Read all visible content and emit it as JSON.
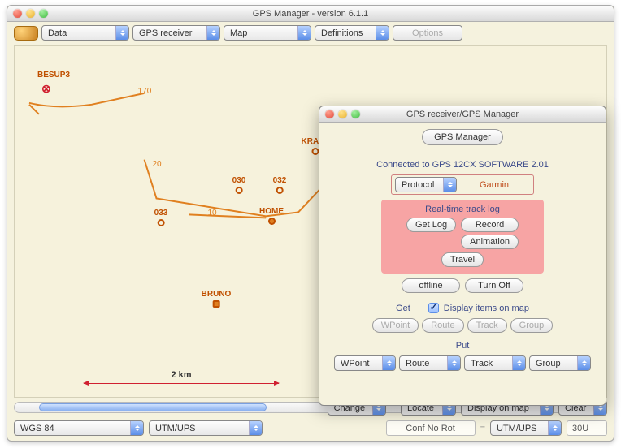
{
  "main": {
    "title": "GPS Manager - version 6.1.1",
    "toolbar": {
      "data": "Data",
      "gps": "GPS receiver",
      "map": "Map",
      "defs": "Definitions",
      "options": "Options"
    },
    "scale_label": "2 km",
    "bottom1": {
      "change": "Change",
      "eq": "=",
      "locate": "Locate",
      "display_on_map": "Display on map",
      "clear": "Clear"
    },
    "bottom2": {
      "datum": "WGS 84",
      "proj_left": "UTM/UPS",
      "conf": "Conf No Rot",
      "proj_right": "UTM/UPS",
      "zone": "30U"
    },
    "waypoints": {
      "besup3": "BESUP3",
      "track_170": "170",
      "track_20": "20",
      "wp_030": "030",
      "wp_032": "032",
      "wp_033": "033",
      "track_10": "10",
      "home": "HOME",
      "krafu": "KRAFU",
      "bruno": "BRUNO"
    }
  },
  "child": {
    "title": "GPS receiver/GPS Manager",
    "manager_btn": "GPS Manager",
    "connected": "Connected to GPS 12CX SOFTWARE  2.01",
    "protocol_label": "Protocol",
    "protocol_value": "Garmin",
    "tracklog": {
      "header": "Real-time track log",
      "get_log": "Get Log",
      "record": "Record",
      "animation": "Animation",
      "travel": "Travel"
    },
    "offline": "offline",
    "turn_off": "Turn Off",
    "get_label": "Get",
    "display_items": "Display items on map",
    "get_buttons": {
      "wpoint": "WPoint",
      "route": "Route",
      "track": "Track",
      "group": "Group"
    },
    "put_label": "Put",
    "put_selects": {
      "wpoint": "WPoint",
      "route": "Route",
      "track": "Track",
      "group": "Group"
    }
  }
}
